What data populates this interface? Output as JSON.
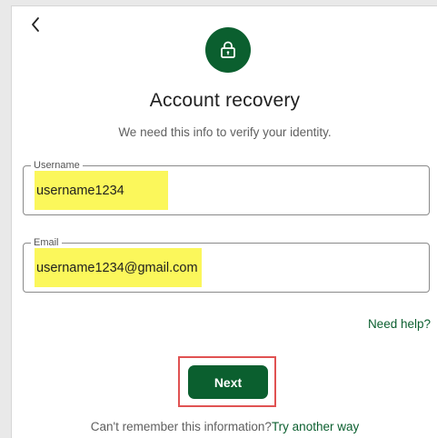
{
  "header": {
    "back_icon": "chevron-left-icon",
    "lock_icon": "lock-icon",
    "title": "Account recovery",
    "subtitle": "We need this info to verify your identity."
  },
  "form": {
    "username": {
      "label": "Username",
      "value": "username1234"
    },
    "email": {
      "label": "Email",
      "value": "username1234@gmail.com"
    }
  },
  "links": {
    "need_help": "Need help?",
    "footer_prompt": "Can't remember this information?",
    "try_another_way": "Try another way"
  },
  "actions": {
    "next_label": "Next"
  },
  "colors": {
    "brand_green": "#0b5f2f",
    "highlight_yellow": "#fbf75b",
    "annotation_red": "#e05252"
  }
}
